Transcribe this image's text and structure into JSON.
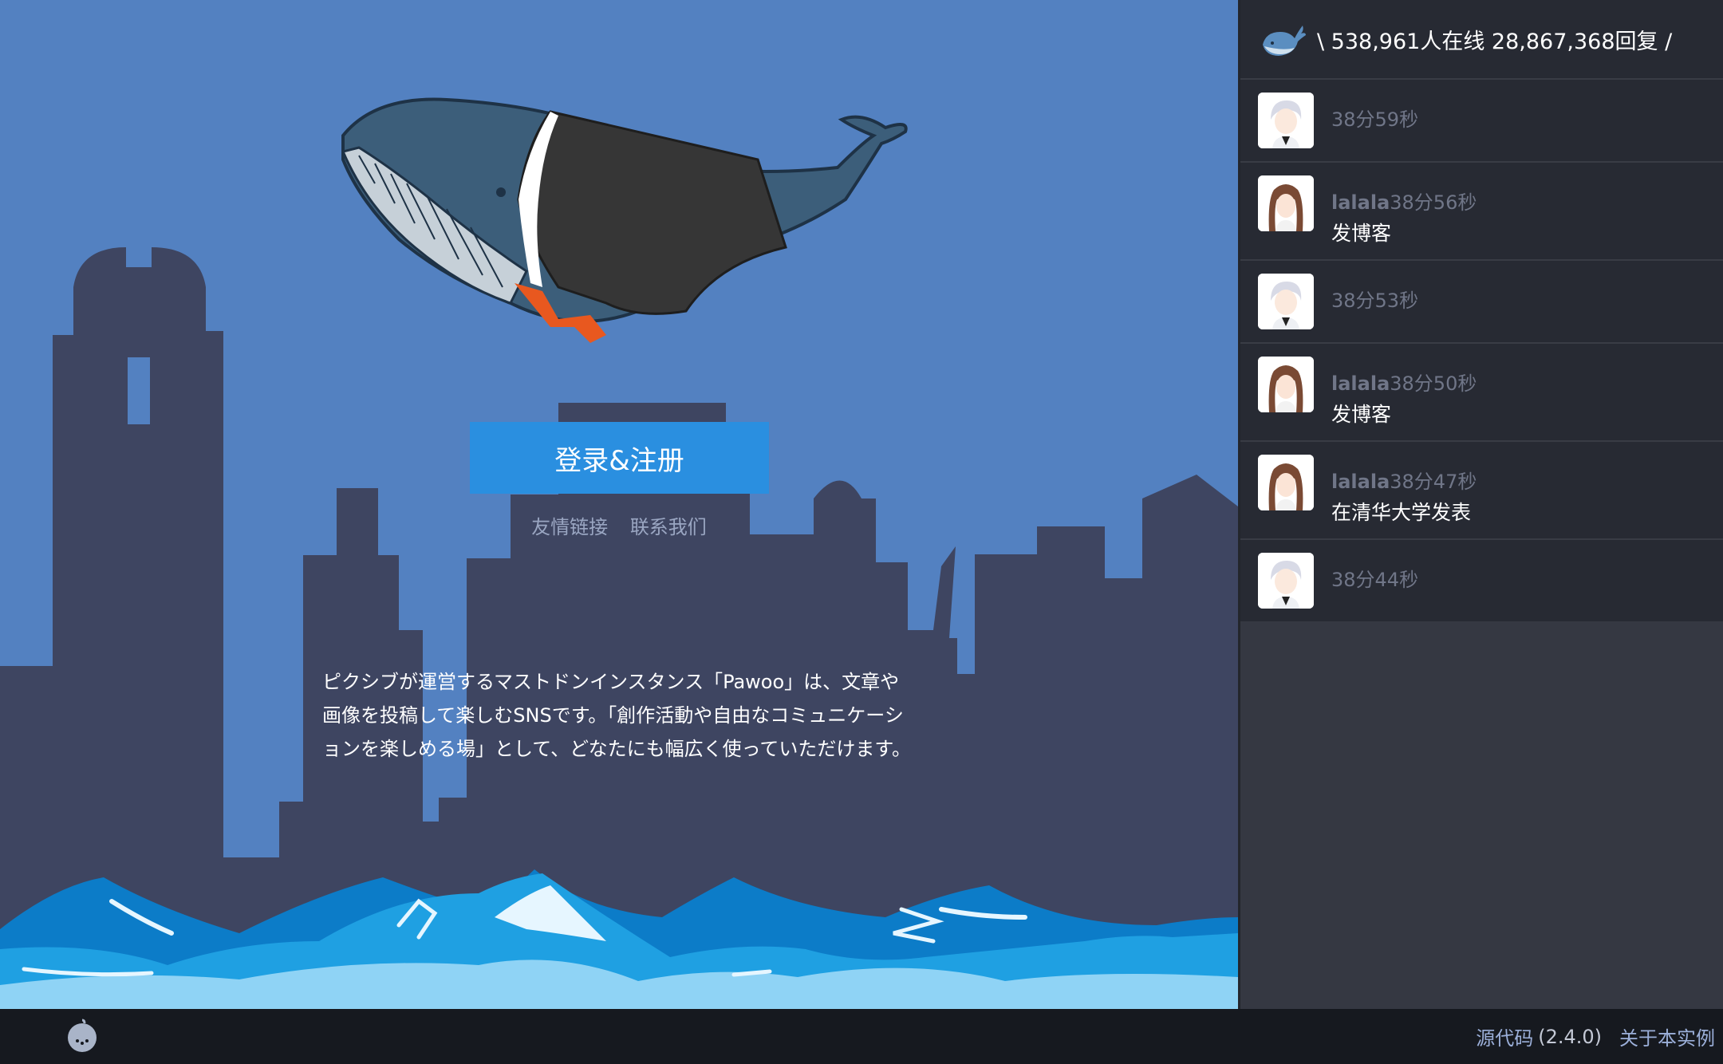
{
  "hero": {
    "login_button": "登录&注册",
    "links": [
      "友情链接",
      "联系我们"
    ],
    "description": "ピクシブが運営するマストドンインスタンス「Pawoo」は、文章や画像を投稿して楽しむSNSです。「創作活動や自由なコミュニケーションを楽しめる場」として、どなたにも幅広く使っていただけます。"
  },
  "sidebar": {
    "stats": "\\ 538,961人在线 28,867,368回复 /",
    "feed": [
      {
        "user": "",
        "time": "38分59秒",
        "action": "",
        "avatar": "white-hair-avatar"
      },
      {
        "user": "lalala",
        "time": "38分56秒",
        "action": "发博客",
        "avatar": "brown-hair-avatar"
      },
      {
        "user": "",
        "time": "38分53秒",
        "action": "",
        "avatar": "white-hair-avatar"
      },
      {
        "user": "lalala",
        "time": "38分50秒",
        "action": "发博客",
        "avatar": "brown-hair-avatar"
      },
      {
        "user": "lalala",
        "time": "38分47秒",
        "action": "在清华大学发表",
        "avatar": "brown-hair-avatar"
      },
      {
        "user": "",
        "time": "38分44秒",
        "action": "",
        "avatar": "white-hair-avatar"
      }
    ]
  },
  "footer": {
    "source_label": "源代码",
    "version": "(2.4.0)",
    "about_label": "关于本实例"
  },
  "colors": {
    "sky": "#5381c1",
    "buildings": "#3e4561",
    "button": "#2a8fe0",
    "sidebar": "#272a33",
    "footer": "#16191f"
  }
}
